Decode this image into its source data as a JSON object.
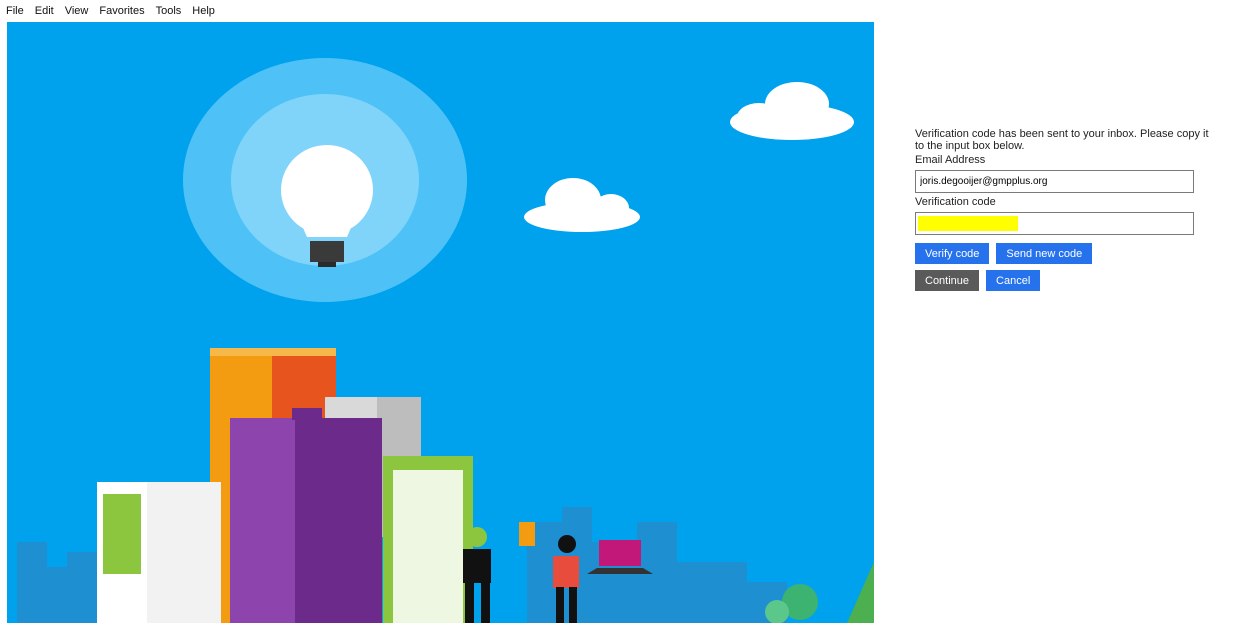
{
  "menubar": {
    "items": [
      "File",
      "Edit",
      "View",
      "Favorites",
      "Tools",
      "Help"
    ]
  },
  "form": {
    "description": "Verification code has been sent to your inbox. Please copy it to the input box below.",
    "email_label": "Email Address",
    "email_value": "joris.degooijer@gmpplus.org",
    "code_label": "Verification code",
    "code_value": "",
    "verify_button": "Verify code",
    "send_new_button": "Send new code",
    "continue_button": "Continue",
    "cancel_button": "Cancel"
  },
  "colors": {
    "sky": "#00a2ed",
    "primary_button": "#2672ec",
    "continue_button": "#5a5a5a",
    "redaction": "#ffff00"
  }
}
